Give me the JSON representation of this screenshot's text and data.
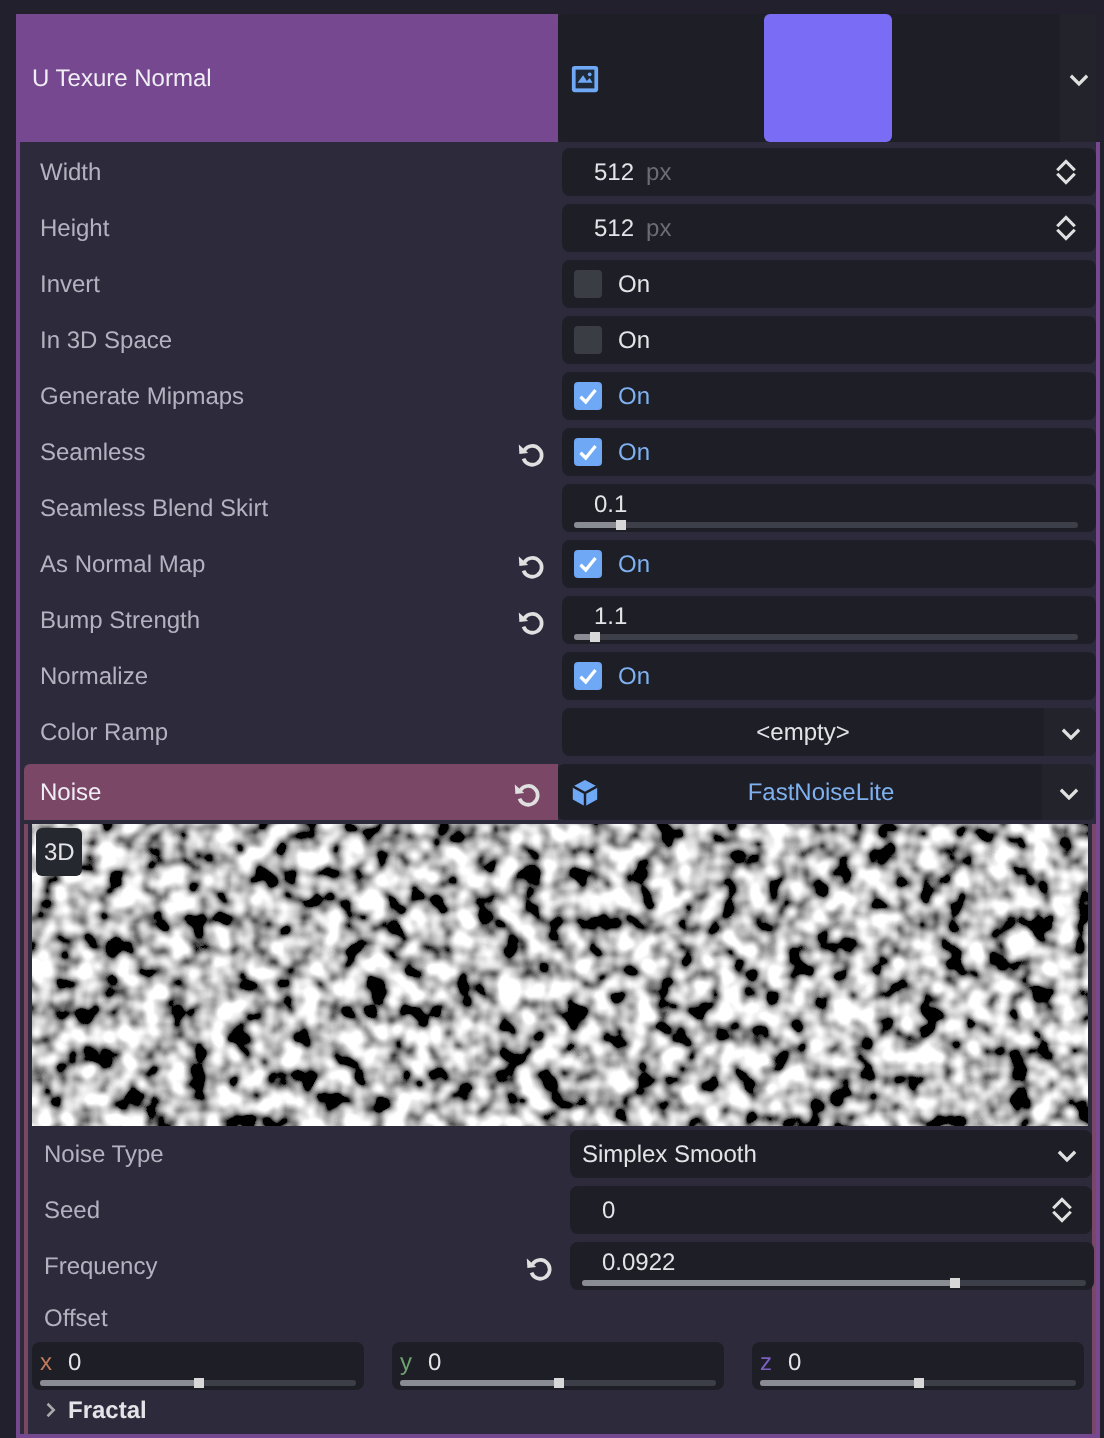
{
  "texture_param": {
    "label": "U Texure Normal"
  },
  "properties": [
    {
      "kind": "spin",
      "label": "Width",
      "value": "512",
      "unit": "px",
      "reset": false
    },
    {
      "kind": "spin",
      "label": "Height",
      "value": "512",
      "unit": "px",
      "reset": false
    },
    {
      "kind": "check",
      "label": "Invert",
      "text": "On",
      "checked": false,
      "reset": false
    },
    {
      "kind": "check",
      "label": "In 3D Space",
      "text": "On",
      "checked": false,
      "reset": false
    },
    {
      "kind": "check",
      "label": "Generate Mipmaps",
      "text": "On",
      "checked": true,
      "reset": false
    },
    {
      "kind": "check",
      "label": "Seamless",
      "text": "On",
      "checked": true,
      "reset": true
    },
    {
      "kind": "slider",
      "label": "Seamless Blend Skirt",
      "value": "0.1",
      "level": 0.09,
      "reset": false
    },
    {
      "kind": "check",
      "label": "As Normal Map",
      "text": "On",
      "checked": true,
      "reset": true
    },
    {
      "kind": "slider",
      "label": "Bump Strength",
      "value": "1.1",
      "level": 0.04,
      "reset": true
    },
    {
      "kind": "check",
      "label": "Normalize",
      "text": "On",
      "checked": true,
      "reset": false
    },
    {
      "kind": "resource",
      "label": "Color Ramp",
      "value": "<empty>",
      "reset": false
    }
  ],
  "noise": {
    "label": "Noise",
    "reset": true,
    "value": "FastNoiseLite",
    "badge": "3D",
    "properties": [
      {
        "kind": "dropdown",
        "label": "Noise Type",
        "value": "Simplex Smooth",
        "reset": false
      },
      {
        "kind": "spin",
        "label": "Seed",
        "value": "0",
        "reset": false
      },
      {
        "kind": "slider",
        "label": "Frequency",
        "value": "0.0922",
        "level": 0.74,
        "reset": true
      },
      {
        "kind": "vector",
        "label": "Offset",
        "components": [
          {
            "axis": "x",
            "value": "0",
            "level": 0.5,
            "color": "#c27a5a"
          },
          {
            "axis": "y",
            "value": "0",
            "level": 0.5,
            "color": "#6fa06f"
          },
          {
            "axis": "z",
            "value": "0",
            "level": 0.5,
            "color": "#7a5fc0"
          }
        ]
      }
    ],
    "sections": [
      {
        "label": "Fractal",
        "expanded": false
      }
    ]
  }
}
